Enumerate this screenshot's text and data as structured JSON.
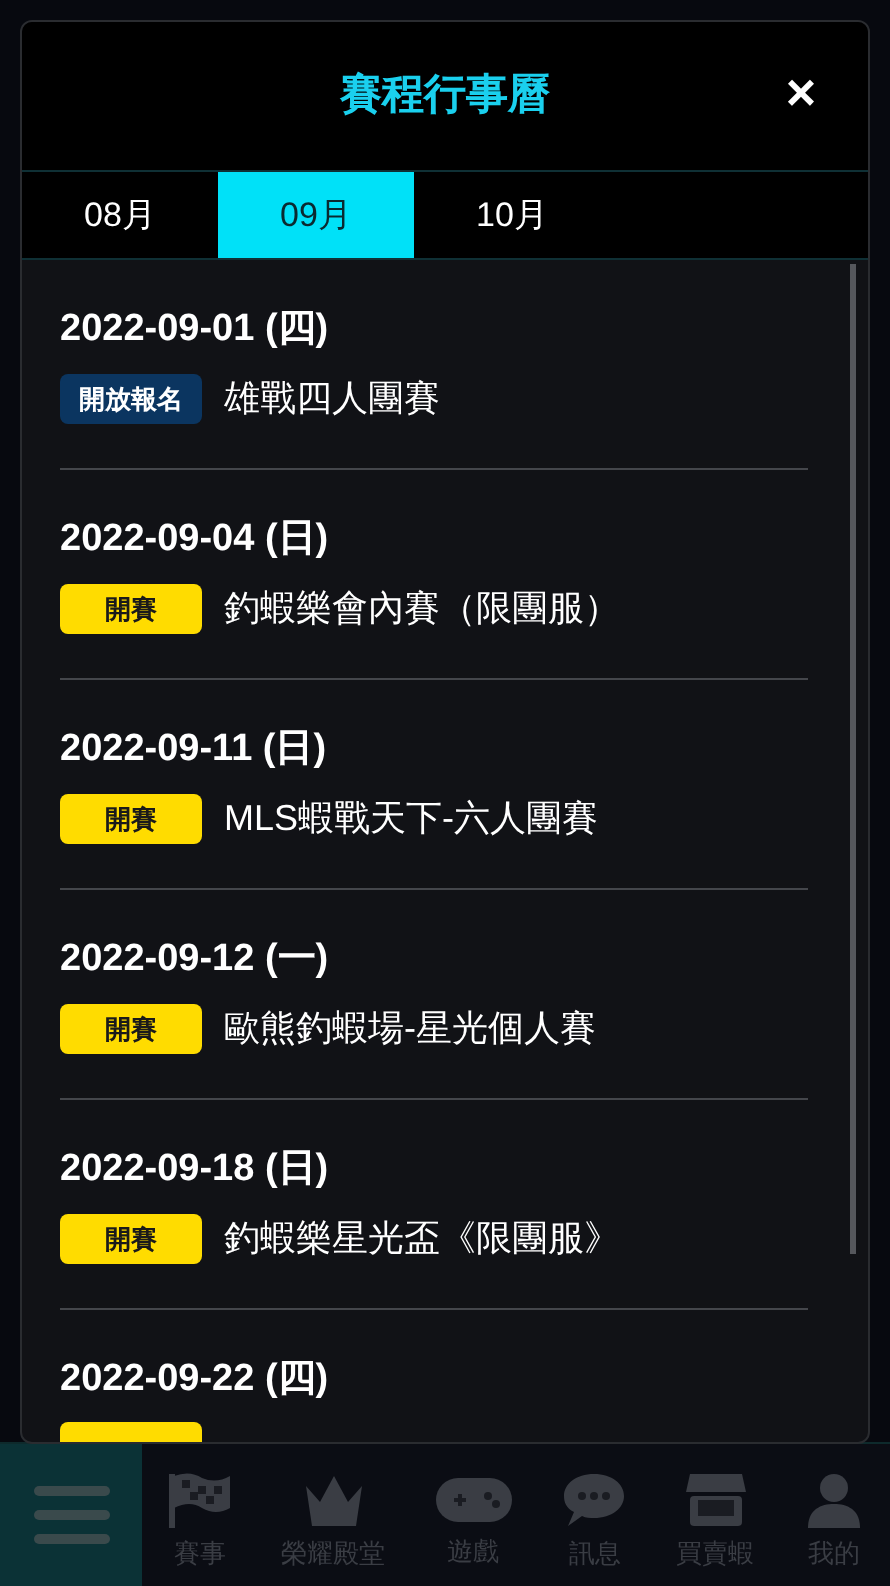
{
  "dialog": {
    "title": "賽程行事曆",
    "close": "×"
  },
  "tabs": [
    {
      "label": "08月",
      "selected": false
    },
    {
      "label": "09月",
      "selected": true
    },
    {
      "label": "10月",
      "selected": false
    }
  ],
  "events": [
    {
      "date": "2022-09-01 (四)",
      "badge": {
        "kind": "signup",
        "label": "開放報名"
      },
      "name": "雄戰四人團賽"
    },
    {
      "date": "2022-09-04 (日)",
      "badge": {
        "kind": "start",
        "label": "開賽"
      },
      "name": "釣蝦樂會內賽（限團服）"
    },
    {
      "date": "2022-09-11 (日)",
      "badge": {
        "kind": "start",
        "label": "開賽"
      },
      "name": "MLS蝦戰天下-六人團賽"
    },
    {
      "date": "2022-09-12 (一)",
      "badge": {
        "kind": "start",
        "label": "開賽"
      },
      "name": "歐熊釣蝦場-星光個人賽"
    },
    {
      "date": "2022-09-18 (日)",
      "badge": {
        "kind": "start",
        "label": "開賽"
      },
      "name": "釣蝦樂星光盃《限團服》"
    },
    {
      "date": "2022-09-22 (四)",
      "badge": {
        "kind": "start"
      }
    }
  ],
  "bottom_nav": [
    {
      "kind": "flag",
      "label": "賽事"
    },
    {
      "kind": "crown",
      "label": "榮耀殿堂"
    },
    {
      "kind": "gamepad",
      "label": "遊戲"
    },
    {
      "kind": "chat",
      "label": "訊息"
    },
    {
      "kind": "store",
      "label": "買賣蝦"
    },
    {
      "kind": "user",
      "label": "我的"
    }
  ]
}
